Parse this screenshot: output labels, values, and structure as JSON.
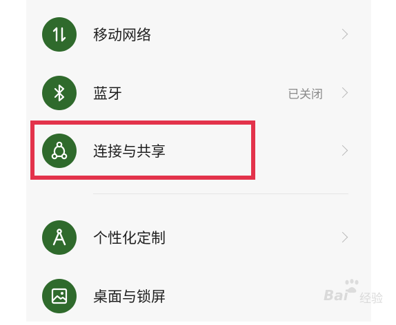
{
  "settings": {
    "items": [
      {
        "label": "移动网络",
        "value": "",
        "icon": "data-arrows-icon"
      },
      {
        "label": "蓝牙",
        "value": "已关闭",
        "icon": "bluetooth-icon"
      },
      {
        "label": "连接与共享",
        "value": "",
        "icon": "share-nodes-icon"
      },
      {
        "label": "个性化定制",
        "value": "",
        "icon": "compass-icon"
      },
      {
        "label": "桌面与锁屏",
        "value": "",
        "icon": "image-icon"
      }
    ]
  },
  "colors": {
    "icon_bg": "#2f6a2c",
    "highlight": "#e3334b",
    "panel_bg": "#f7f7f7"
  },
  "watermark": {
    "brand": "Bai",
    "text": "经验",
    "logo": "baidu-paw-logo"
  }
}
